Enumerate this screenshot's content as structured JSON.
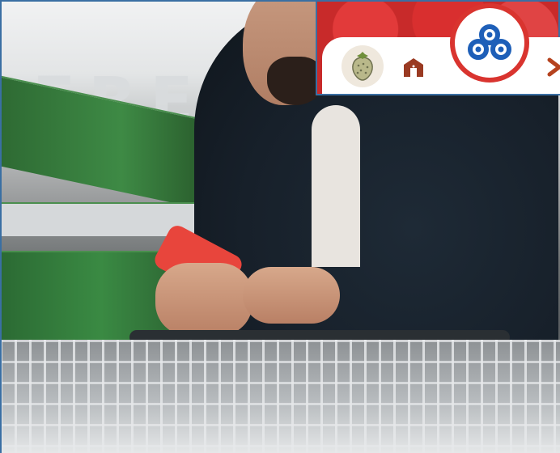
{
  "image": {
    "scene": "shopper-in-grocery-store",
    "store_sign_text": "FRESH"
  },
  "app_strip": {
    "icons": [
      {
        "name": "strawberry-icon"
      },
      {
        "name": "store-icon"
      },
      {
        "name": "logo-icon"
      },
      {
        "name": "next-icon"
      }
    ],
    "accent_color": "#d9342f",
    "logo_color": "#1e5fb8"
  }
}
